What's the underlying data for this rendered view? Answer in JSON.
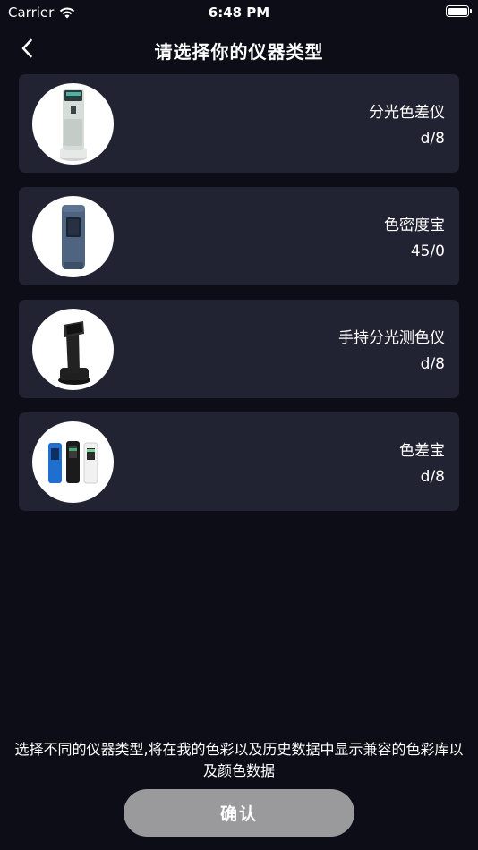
{
  "status_bar": {
    "carrier": "Carrier",
    "time": "6:48 PM"
  },
  "nav": {
    "title": "请选择你的仪器类型",
    "back_icon": "chevron-left-icon"
  },
  "instruments": [
    {
      "name": "分光色差仪",
      "spec": "d/8",
      "image": "benchtop-spectrophotometer"
    },
    {
      "name": "色密度宝",
      "spec": "45/0",
      "image": "blue-densitometer"
    },
    {
      "name": "手持分光测色仪",
      "spec": "d/8",
      "image": "handheld-black-spectrophotometer"
    },
    {
      "name": "色差宝",
      "spec": "d/8",
      "image": "three-colorimeters"
    }
  ],
  "hint": "选择不同的仪器类型,将在我的色彩以及历史数据中显示兼容的色彩库以及颜色数据",
  "confirm_label": "确认",
  "colors": {
    "background": "#0c0d16",
    "card": "#212332",
    "button": "#9a9a9c",
    "text": "#ffffff"
  }
}
